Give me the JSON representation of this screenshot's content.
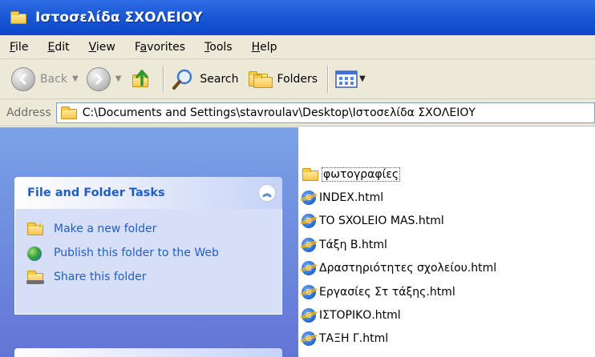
{
  "window": {
    "title": "Ιστοσελίδα ΣΧΟΛΕΙΟΥ"
  },
  "menu": [
    {
      "label": "File",
      "u": "F",
      "rest": "ile"
    },
    {
      "label": "Edit",
      "u": "E",
      "rest": "dit"
    },
    {
      "label": "View",
      "u": "V",
      "rest": "iew"
    },
    {
      "label": "Favorites",
      "pre": "F",
      "u": "a",
      "rest": "vorites"
    },
    {
      "label": "Tools",
      "u": "T",
      "rest": "ools"
    },
    {
      "label": "Help",
      "u": "H",
      "rest": "elp"
    }
  ],
  "toolbar": {
    "back_label": "Back",
    "search_label": "Search",
    "folders_label": "Folders"
  },
  "address": {
    "label": "Address",
    "path": "C:\\Documents and Settings\\stavroulav\\Desktop\\Ιστοσελίδα ΣΧΟΛΕΙΟΥ"
  },
  "tasks": {
    "title": "File and Folder Tasks",
    "items": [
      {
        "label": "Make a new folder",
        "icon": "new-folder-icon"
      },
      {
        "label": "Publish this folder to the Web",
        "icon": "publish-web-icon"
      },
      {
        "label": "Share this folder",
        "icon": "share-folder-icon"
      }
    ]
  },
  "files": [
    {
      "name": "φωτογραφίες",
      "type": "folder",
      "selected": true
    },
    {
      "name": "INDEX.html",
      "type": "html"
    },
    {
      "name": "TO SXOLEIO MAS.html",
      "type": "html"
    },
    {
      "name": "Τάξη Β.html",
      "type": "html"
    },
    {
      "name": "Δραστηριότητες σχολείου.html",
      "type": "html"
    },
    {
      "name": "Εργασίες Στ τάξης.html",
      "type": "html"
    },
    {
      "name": "ΙΣΤΟΡΙΚΟ.html",
      "type": "html"
    },
    {
      "name": "ΤΑΞΗ Γ.html",
      "type": "html"
    }
  ],
  "colors": {
    "titlebar": "#0a48c9",
    "task_link": "#215dc6",
    "leftpane": "#7ba2e7"
  }
}
